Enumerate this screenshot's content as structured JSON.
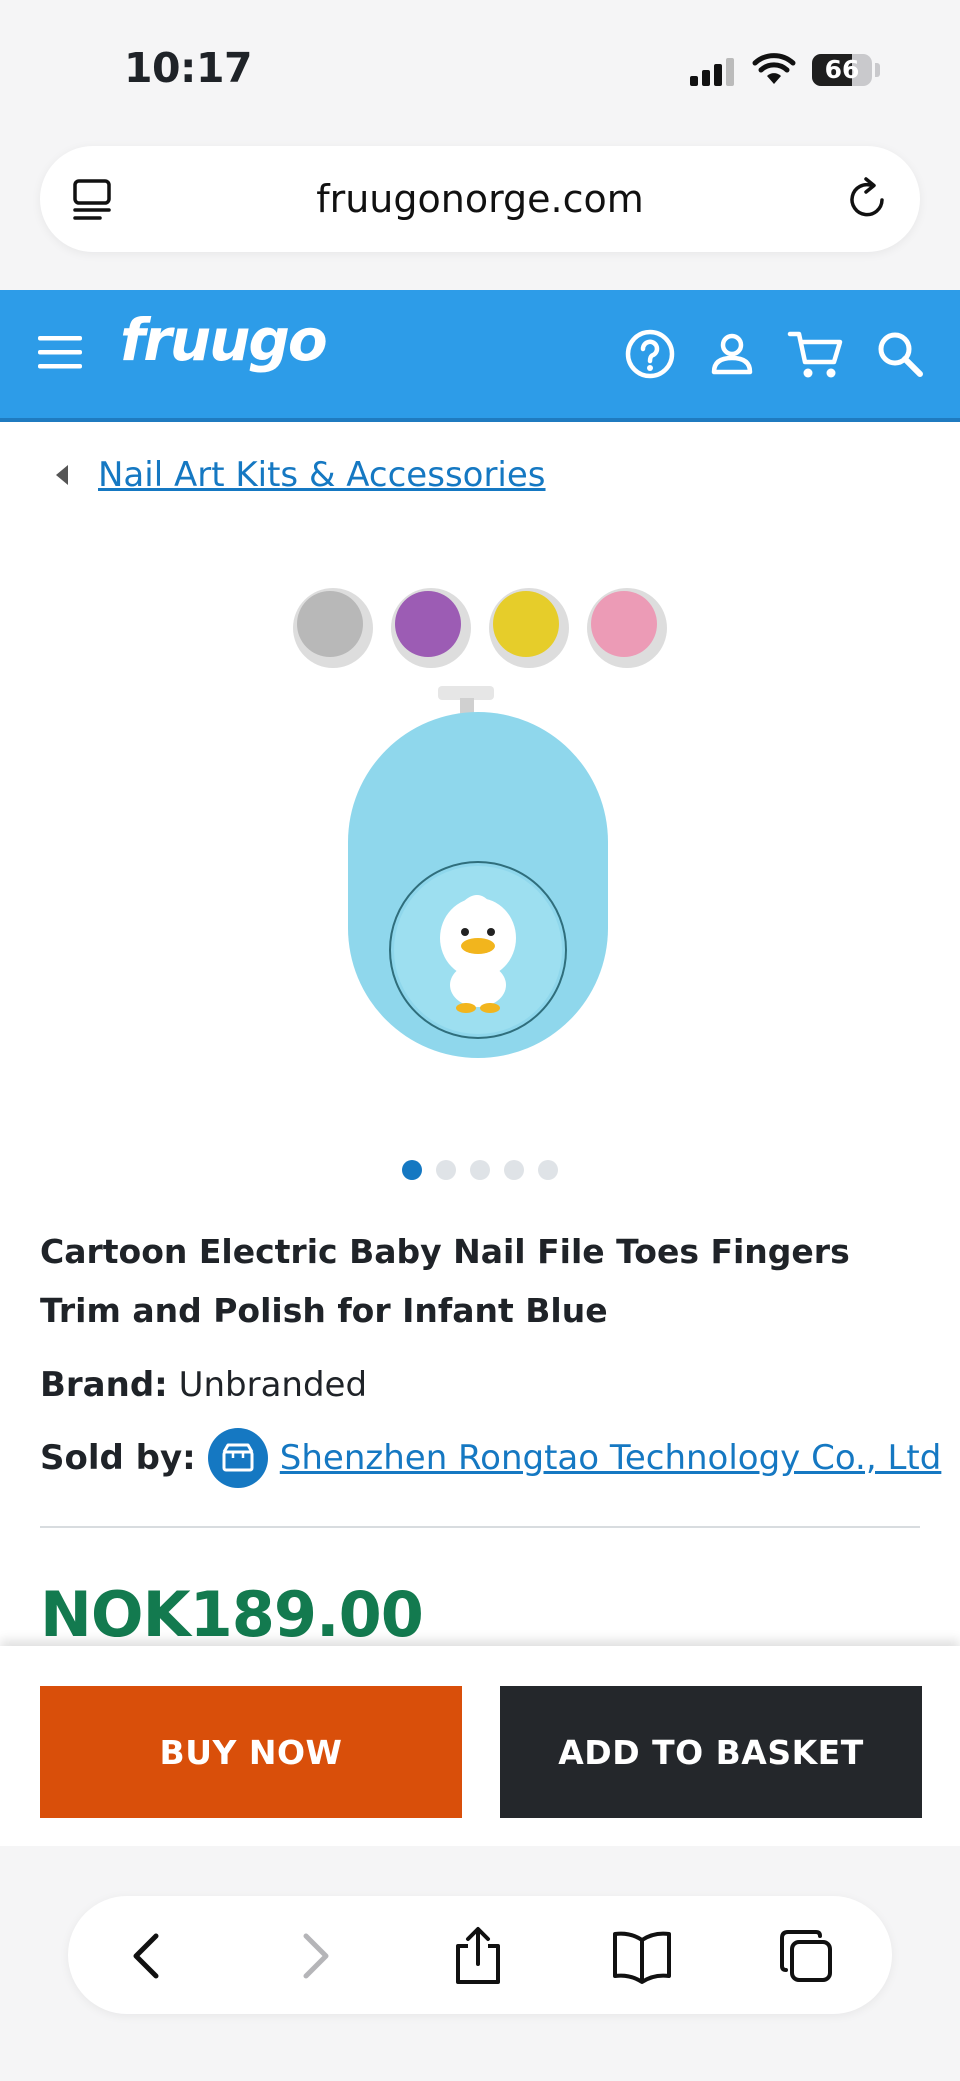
{
  "status_bar": {
    "time": "10:17",
    "battery": "66",
    "battery_level": 0.66
  },
  "browser": {
    "url": "fruugonorge.com"
  },
  "site_header": {
    "logo": "fruugo"
  },
  "breadcrumb": {
    "label": "Nail Art Kits & Accessories"
  },
  "product": {
    "title": "Cartoon Electric Baby Nail File Toes Fingers Trim and Polish for Infant Blue",
    "brand_label": "Brand:",
    "brand": "Unbranded",
    "sold_by_label": "Sold by:",
    "seller": "Shenzhen Rongtao Technology Co., Ltd",
    "price": "NOK189.00",
    "image_count": 5,
    "active_image": 1,
    "image_colors": {
      "disc_1": "#b8b8b8",
      "disc_2": "#9c5cb4",
      "disc_3": "#e6cd2a",
      "disc_4": "#ec9bb6",
      "body": "#8fd7ec"
    }
  },
  "actions": {
    "buy_now": "BUY NOW",
    "add_to_basket": "ADD TO BASKET"
  },
  "colors": {
    "header": "#2d9ce8",
    "link": "#1578c2",
    "price": "#137a4f",
    "buy": "#d94f0a",
    "basket": "#24272b"
  }
}
